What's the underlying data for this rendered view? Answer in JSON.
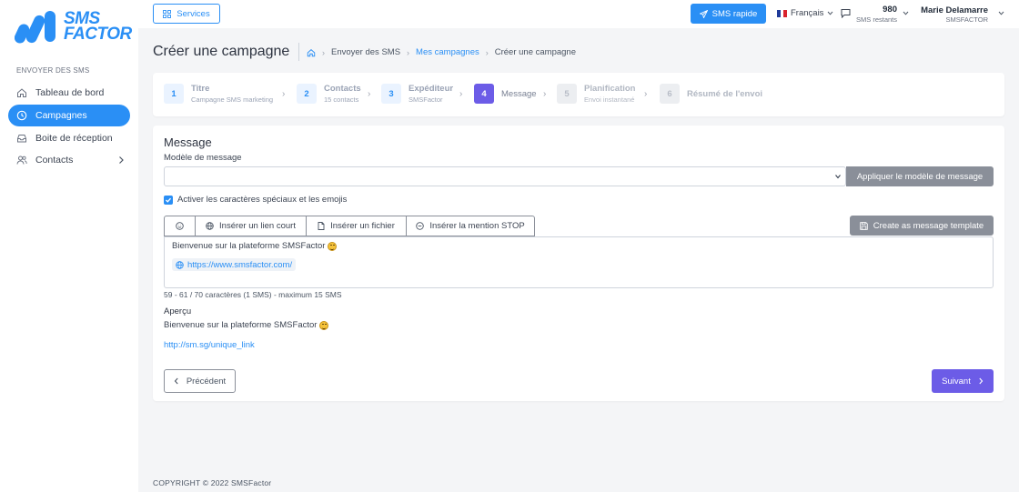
{
  "brand": {
    "logo_line1": "SMS",
    "logo_line2": "FACTOR",
    "accent": "#2a8ff5",
    "purple": "#6c5ce7"
  },
  "sidebar": {
    "section": "ENVOYER DES SMS",
    "items": [
      {
        "label": "Tableau de bord",
        "icon": "home-icon"
      },
      {
        "label": "Campagnes",
        "icon": "clock-icon",
        "active": true
      },
      {
        "label": "Boite de réception",
        "icon": "inbox-icon"
      },
      {
        "label": "Contacts",
        "icon": "users-icon"
      }
    ]
  },
  "topbar": {
    "services": "Services",
    "sms_rapide": "SMS rapide",
    "language": "Français",
    "credits_value": "980",
    "credits_label": "SMS restants",
    "user_name": "Marie Delamarre",
    "user_org": "SMSFACTOR"
  },
  "page": {
    "title": "Créer une campagne",
    "breadcrumb": [
      "Envoyer des SMS",
      "Mes campagnes",
      "Créer une campagne"
    ]
  },
  "steps": [
    {
      "num": "1",
      "title": "Titre",
      "sub": "Campagne SMS marketing",
      "state": "done"
    },
    {
      "num": "2",
      "title": "Contacts",
      "sub": "15 contacts",
      "state": "done"
    },
    {
      "num": "3",
      "title": "Expéditeur",
      "sub": "SMSFactor",
      "state": "done"
    },
    {
      "num": "4",
      "title": "Message",
      "sub": "",
      "state": "active"
    },
    {
      "num": "5",
      "title": "Planification",
      "sub": "Envoi instantané",
      "state": "todo"
    },
    {
      "num": "6",
      "title": "Résumé de l'envoi",
      "sub": "",
      "state": "todo"
    }
  ],
  "message": {
    "section_title": "Message",
    "model_label": "Modèle de message",
    "model_value": "",
    "apply_button": "Appliquer le modèle de message",
    "checkbox_label": "Activer les caractères spéciaux et les emojis",
    "checkbox_checked": true,
    "toolbar": {
      "short_link": "Insérer un lien court",
      "file": "Insérer un fichier",
      "stop": "Insérer la mention STOP"
    },
    "create_template_button": "Create as message template",
    "body_text": "Bienvenue sur la plateforme SMSFactor",
    "body_link": "https://www.smsfactor.com/",
    "counter": "59 - 61 / 70 caractères (1 SMS) - maximum 15 SMS",
    "preview_label": "Aperçu",
    "preview_text": "Bienvenue sur la plateforme SMSFactor",
    "preview_link": "http://sm.sg/unique_link",
    "prev_button": "Précédent",
    "next_button": "Suivant"
  },
  "footer": "COPYRIGHT © 2022 SMSFactor"
}
